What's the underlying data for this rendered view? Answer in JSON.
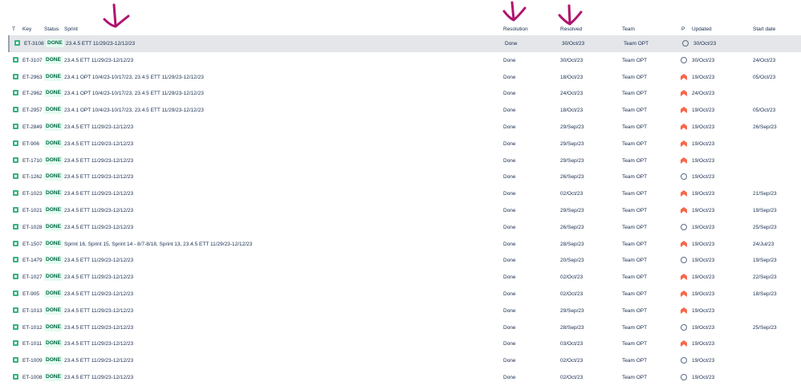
{
  "columns": {
    "type": "T",
    "key": "Key",
    "status": "Status",
    "sprint": "Sprint",
    "resolution": "Resolution",
    "resolved": "Resolved",
    "team": "Team",
    "priority": "P",
    "updated": "Updated",
    "start_date": "Start date"
  },
  "colors": {
    "annotation_arrow": "#b0136e",
    "done_lozenge_bg": "#e3fcef",
    "done_lozenge_text": "#006644",
    "priority_high": "#f7674a",
    "story_icon": "#36b37e",
    "selected_row_bg": "#e4e6ea"
  },
  "annotation_arrows": [
    "sprint-column-arrow",
    "resolution-column-arrow",
    "resolved-column-arrow"
  ],
  "rows": [
    {
      "key": "ET-3108",
      "status": "DONE",
      "sprint": "23.4.5 ETT 11/29/23-12/12/23",
      "resolution": "Done",
      "resolved": "30/Oct/23",
      "team": "Team OPT",
      "priority": "none",
      "updated": "30/Oct/23",
      "start_date": "",
      "selected": true
    },
    {
      "key": "ET-3107",
      "status": "DONE",
      "sprint": "23.4.5 ETT 11/29/23-12/12/23",
      "resolution": "Done",
      "resolved": "30/Oct/23",
      "team": "Team OPT",
      "priority": "none",
      "updated": "30/Oct/23",
      "start_date": "24/Oct/23"
    },
    {
      "key": "ET-2963",
      "status": "DONE",
      "sprint": "23.4.1 OPT 10/4/23-10/17/23, 23.4.5 ETT 11/29/23-12/12/23",
      "resolution": "Done",
      "resolved": "18/Oct/23",
      "team": "Team OPT",
      "priority": "high",
      "updated": "19/Oct/23",
      "start_date": "05/Oct/23"
    },
    {
      "key": "ET-2962",
      "status": "DONE",
      "sprint": "23.4.1 OPT 10/4/23-10/17/23, 23.4.5 ETT 11/29/23-12/12/23",
      "resolution": "Done",
      "resolved": "24/Oct/23",
      "team": "Team OPT",
      "priority": "high",
      "updated": "24/Oct/23",
      "start_date": ""
    },
    {
      "key": "ET-2957",
      "status": "DONE",
      "sprint": "23.4.1 OPT 10/4/23-10/17/23, 23.4.5 ETT 11/29/23-12/12/23",
      "resolution": "Done",
      "resolved": "18/Oct/23",
      "team": "Team OPT",
      "priority": "high",
      "updated": "19/Oct/23",
      "start_date": "05/Oct/23"
    },
    {
      "key": "ET-2849",
      "status": "DONE",
      "sprint": "23.4.5 ETT 11/29/23-12/12/23",
      "resolution": "Done",
      "resolved": "29/Sep/23",
      "team": "Team OPT",
      "priority": "high",
      "updated": "19/Oct/23",
      "start_date": "26/Sep/23"
    },
    {
      "key": "ET-906",
      "status": "DONE",
      "sprint": "23.4.5 ETT 11/29/23-12/12/23",
      "resolution": "Done",
      "resolved": "29/Sep/23",
      "team": "Team OPT",
      "priority": "high",
      "updated": "19/Oct/23",
      "start_date": ""
    },
    {
      "key": "ET-1710",
      "status": "DONE",
      "sprint": "23.4.5 ETT 11/29/23-12/12/23",
      "resolution": "Done",
      "resolved": "29/Sep/23",
      "team": "Team OPT",
      "priority": "high",
      "updated": "19/Oct/23",
      "start_date": ""
    },
    {
      "key": "ET-1262",
      "status": "DONE",
      "sprint": "23.4.5 ETT 11/29/23-12/12/23",
      "resolution": "Done",
      "resolved": "26/Sep/23",
      "team": "Team OPT",
      "priority": "none",
      "updated": "19/Oct/23",
      "start_date": ""
    },
    {
      "key": "ET-1023",
      "status": "DONE",
      "sprint": "23.4.5 ETT 11/29/23-12/12/23",
      "resolution": "Done",
      "resolved": "02/Oct/23",
      "team": "Team OPT",
      "priority": "high",
      "updated": "19/Oct/23",
      "start_date": "21/Sep/23"
    },
    {
      "key": "ET-1021",
      "status": "DONE",
      "sprint": "23.4.5 ETT 11/29/23-12/12/23",
      "resolution": "Done",
      "resolved": "29/Sep/23",
      "team": "Team OPT",
      "priority": "high",
      "updated": "19/Oct/23",
      "start_date": "19/Sep/23"
    },
    {
      "key": "ET-1028",
      "status": "DONE",
      "sprint": "23.4.5 ETT 11/29/23-12/12/23",
      "resolution": "Done",
      "resolved": "26/Sep/23",
      "team": "Team OPT",
      "priority": "none",
      "updated": "19/Oct/23",
      "start_date": "25/Sep/23"
    },
    {
      "key": "ET-1507",
      "status": "DONE",
      "sprint": "Sprint 16, Sprint 15, Sprint 14 - 8/7-8/18, Sprint 13, 23.4.5 ETT 11/29/23-12/12/23",
      "resolution": "Done",
      "resolved": "28/Sep/23",
      "team": "Team OPT",
      "priority": "high",
      "updated": "19/Oct/23",
      "start_date": "24/Jul/23"
    },
    {
      "key": "ET-1479",
      "status": "DONE",
      "sprint": "23.4.5 ETT 11/29/23-12/12/23",
      "resolution": "Done",
      "resolved": "20/Sep/23",
      "team": "Team OPT",
      "priority": "none",
      "updated": "19/Oct/23",
      "start_date": "19/Sep/23"
    },
    {
      "key": "ET-1027",
      "status": "DONE",
      "sprint": "23.4.5 ETT 11/29/23-12/12/23",
      "resolution": "Done",
      "resolved": "02/Oct/23",
      "team": "Team OPT",
      "priority": "high",
      "updated": "19/Oct/23",
      "start_date": "22/Sep/23"
    },
    {
      "key": "ET-905",
      "status": "DONE",
      "sprint": "23.4.5 ETT 11/29/23-12/12/23",
      "resolution": "Done",
      "resolved": "02/Oct/23",
      "team": "Team OPT",
      "priority": "high",
      "updated": "19/Oct/23",
      "start_date": "18/Sep/23"
    },
    {
      "key": "ET-1013",
      "status": "DONE",
      "sprint": "23.4.5 ETT 11/29/23-12/12/23",
      "resolution": "Done",
      "resolved": "29/Sep/23",
      "team": "Team OPT",
      "priority": "high",
      "updated": "19/Oct/23",
      "start_date": ""
    },
    {
      "key": "ET-1012",
      "status": "DONE",
      "sprint": "23.4.5 ETT 11/29/23-12/12/23",
      "resolution": "Done",
      "resolved": "28/Sep/23",
      "team": "Team OPT",
      "priority": "none",
      "updated": "19/Oct/23",
      "start_date": "25/Sep/23"
    },
    {
      "key": "ET-1011",
      "status": "DONE",
      "sprint": "23.4.5 ETT 11/29/23-12/12/23",
      "resolution": "Done",
      "resolved": "03/Oct/23",
      "team": "Team OPT",
      "priority": "high",
      "updated": "19/Oct/23",
      "start_date": ""
    },
    {
      "key": "ET-1009",
      "status": "DONE",
      "sprint": "23.4.5 ETT 11/29/23-12/12/23",
      "resolution": "Done",
      "resolved": "02/Oct/23",
      "team": "Team OPT",
      "priority": "none",
      "updated": "19/Oct/23",
      "start_date": ""
    },
    {
      "key": "ET-1008",
      "status": "DONE",
      "sprint": "23.4.5 ETT 11/29/23-12/12/23",
      "resolution": "Done",
      "resolved": "02/Oct/23",
      "team": "Team OPT",
      "priority": "none",
      "updated": "19/Oct/23",
      "start_date": ""
    }
  ]
}
